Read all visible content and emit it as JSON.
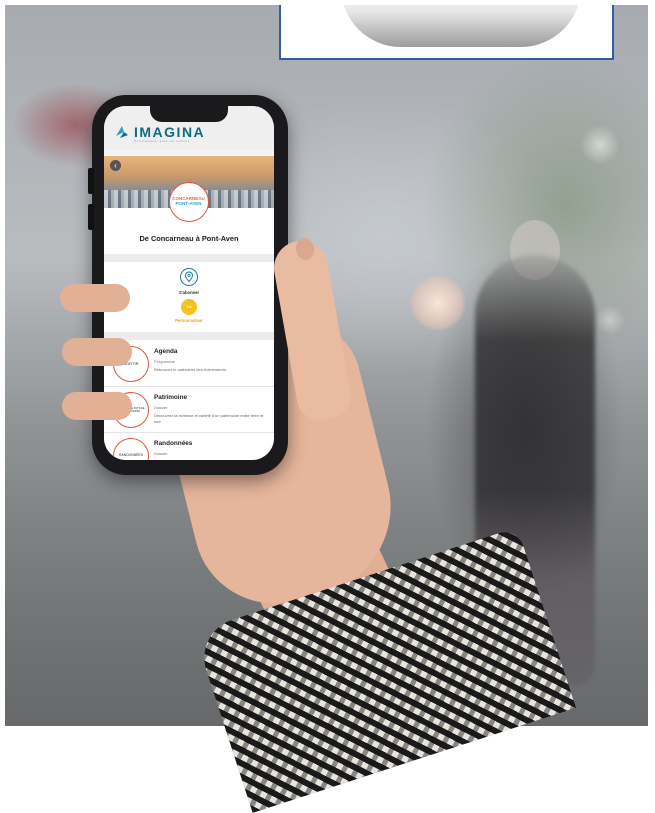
{
  "app": {
    "logo_text": "IMAGINA",
    "logo_tagline": "Communiquer avec les mobiles",
    "page_title": "De Concarneau à Pont-Aven",
    "badge_line1": "CONCARNEAU",
    "badge_line2": "PONT-AVEN"
  },
  "actions": {
    "subscribe_label": "S'abonner",
    "customize_badge": "1 ▸",
    "customize_label": "Personnaliser"
  },
  "list": [
    {
      "thumb": "SORTIR",
      "title": "Agenda",
      "type": "Programme",
      "desc": "Retrouvez le calendrier des évènements."
    },
    {
      "thumb": "PATRIMOINE PAYS DE DÉCOUVERTE",
      "title": "Patrimoine",
      "type": "Dossier",
      "desc": "Découvrez la richesse et variété d'un patrimoine entre terre et mer."
    },
    {
      "thumb": "RANDONNÉES",
      "title": "Randonnées",
      "type": "Dossier",
      "desc": ""
    }
  ],
  "colors": {
    "brand": "#0d6b8a",
    "accent_orange": "#e0573f",
    "accent_yellow": "#f4c21e",
    "inset_border": "#2f5ea6"
  },
  "icons": [
    "imagina-logo-icon",
    "back-chevron-icon",
    "map-pin-icon"
  ]
}
